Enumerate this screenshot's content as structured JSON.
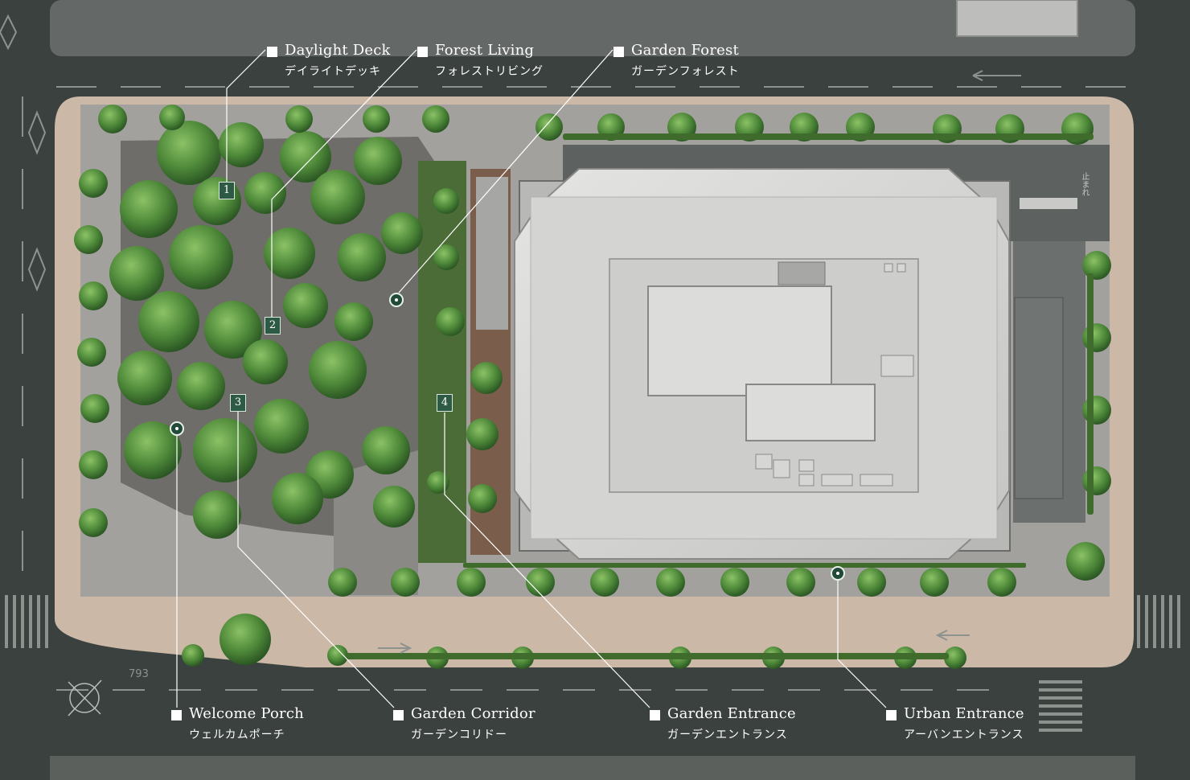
{
  "callouts": [
    {
      "num": "1",
      "en": "Daylight Deck",
      "jp": "デイライトデッキ"
    },
    {
      "num": "2",
      "en": "Forest Living",
      "jp": "フォレストリビング"
    },
    {
      "num": "",
      "en": "Garden Forest",
      "jp": "ガーデンフォレスト"
    },
    {
      "num": "3",
      "en": "Welcome Porch",
      "jp": "ウェルカムポーチ"
    },
    {
      "num": "4",
      "en": "Garden Corridor",
      "jp": "ガーデンコリドー"
    },
    {
      "num": "",
      "en": "Garden Entrance",
      "jp": "ガーデンエントランス"
    },
    {
      "num": "",
      "en": "Urban Entrance",
      "jp": "アーバンエントランス"
    }
  ],
  "road_markings": {
    "right_upper": "止まれ",
    "lower_left_lines": [
      "7",
      "9",
      "3"
    ]
  },
  "icons": {
    "compass": "compass-rose-icon",
    "entrance_pin": "location-pin-icon"
  },
  "colors": {
    "road": "#3a403d",
    "sidewalk": "#cbb8a6",
    "plaza": "#9a9895",
    "tree": "#4f8a3a",
    "building_roof": "#d8d8d6",
    "badge": "#2d5a44",
    "label_text": "#ffffff"
  }
}
